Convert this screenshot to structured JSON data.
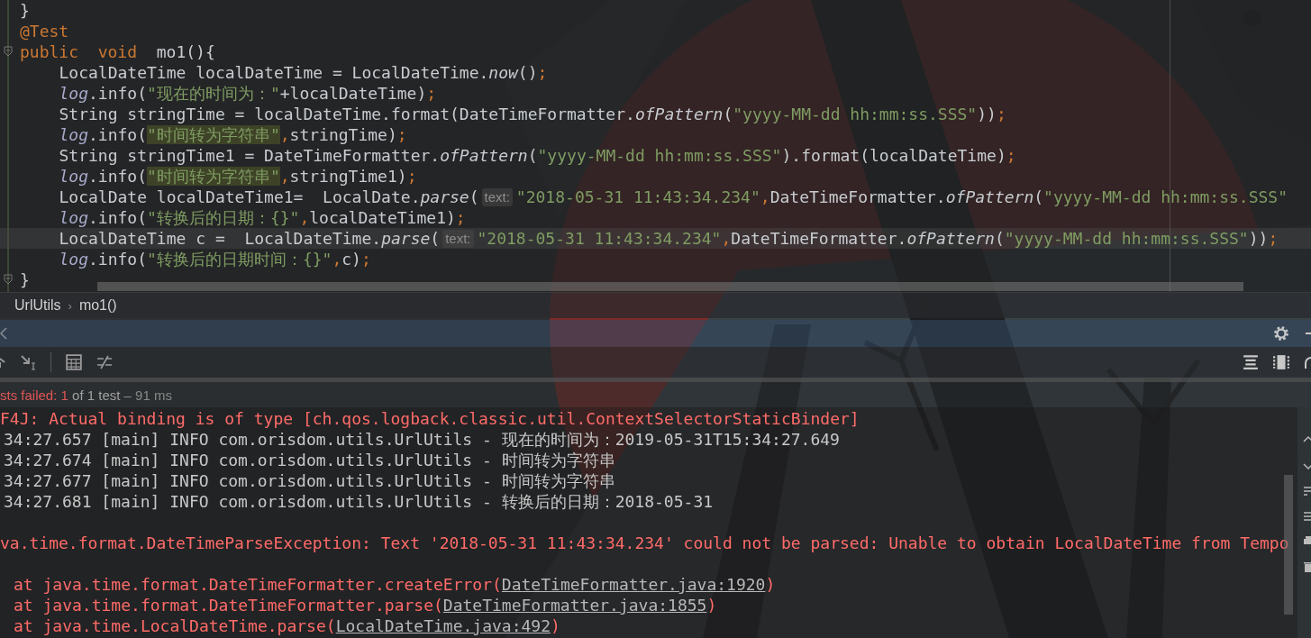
{
  "editor": {
    "code": [
      {
        "current": false,
        "segments": [
          {
            "text": "}",
            "kind": "plain"
          }
        ]
      },
      {
        "current": false,
        "segments": [
          {
            "text": "@Test",
            "kind": "annotation"
          }
        ]
      },
      {
        "current": false,
        "folded_marker": true,
        "segments": [
          {
            "text": "public  void  ",
            "kind": "keyword"
          },
          {
            "text": "mo1(){",
            "kind": "plain"
          }
        ],
        "children": [
          {
            "current": false,
            "segments": [
              {
                "text": "LocalDateTime localDateTime = LocalDateTime.",
                "kind": "plain"
              },
              {
                "text": "now",
                "kind": "italic"
              },
              {
                "text": "()",
                "kind": "plain"
              },
              {
                "text": ";",
                "kind": "punct"
              }
            ]
          },
          {
            "current": false,
            "segments": [
              {
                "text": "log",
                "kind": "static"
              },
              {
                "text": ".info(",
                "kind": "plain"
              },
              {
                "text": "\"现在的时间为：\"",
                "kind": "string"
              },
              {
                "text": "+localDateTime)",
                "kind": "plain"
              },
              {
                "text": ";",
                "kind": "punct"
              }
            ]
          },
          {
            "current": false,
            "segments": [
              {
                "text": "String stringTime = localDateTime.format(DateTimeFormatter.",
                "kind": "plain"
              },
              {
                "text": "ofPattern",
                "kind": "italic"
              },
              {
                "text": "(",
                "kind": "plain"
              },
              {
                "text": "\"yyyy-MM-dd hh:mm:ss.SSS\"",
                "kind": "string"
              },
              {
                "text": "))",
                "kind": "plain"
              },
              {
                "text": ";",
                "kind": "punct"
              }
            ]
          },
          {
            "current": false,
            "segments": [
              {
                "text": "log",
                "kind": "static"
              },
              {
                "text": ".info(",
                "kind": "plain"
              },
              {
                "text": "\"时间转为字符串\"",
                "kind": "string_marked"
              },
              {
                "text": ",",
                "kind": "punct"
              },
              {
                "text": "stringTime)",
                "kind": "plain"
              },
              {
                "text": ";",
                "kind": "punct"
              }
            ]
          },
          {
            "current": false,
            "segments": [
              {
                "text": "String stringTime1 = DateTimeFormatter.",
                "kind": "plain"
              },
              {
                "text": "ofPattern",
                "kind": "italic"
              },
              {
                "text": "(",
                "kind": "plain"
              },
              {
                "text": "\"yyyy-MM-dd hh:mm:ss.SSS\"",
                "kind": "string"
              },
              {
                "text": ").format(localDateTime)",
                "kind": "plain"
              },
              {
                "text": ";",
                "kind": "punct"
              }
            ]
          },
          {
            "current": false,
            "segments": [
              {
                "text": "log",
                "kind": "static"
              },
              {
                "text": ".info(",
                "kind": "plain"
              },
              {
                "text": "\"时间转为字符串\"",
                "kind": "string_marked"
              },
              {
                "text": ",",
                "kind": "punct"
              },
              {
                "text": "stringTime1)",
                "kind": "plain"
              },
              {
                "text": ";",
                "kind": "punct"
              }
            ]
          },
          {
            "current": false,
            "segments": [
              {
                "text": "LocalDate localDateTime1=  LocalDate.",
                "kind": "plain"
              },
              {
                "text": "parse",
                "kind": "italic"
              },
              {
                "text": "(",
                "kind": "plain"
              },
              {
                "text": "text:",
                "kind": "hint"
              },
              {
                "text": "\"2018-05-31 11:43:34.234\"",
                "kind": "string"
              },
              {
                "text": ",",
                "kind": "punct"
              },
              {
                "text": "DateTimeFormatter.",
                "kind": "plain"
              },
              {
                "text": "ofPattern",
                "kind": "italic"
              },
              {
                "text": "(",
                "kind": "plain"
              },
              {
                "text": "\"yyyy-MM-dd hh:mm:ss.SSS\"",
                "kind": "string"
              }
            ]
          },
          {
            "current": false,
            "segments": [
              {
                "text": "log",
                "kind": "static"
              },
              {
                "text": ".info(",
                "kind": "plain"
              },
              {
                "text": "\"转换后的日期：{}\"",
                "kind": "string"
              },
              {
                "text": ",",
                "kind": "punct"
              },
              {
                "text": "localDateTime1)",
                "kind": "plain"
              },
              {
                "text": ";",
                "kind": "punct"
              }
            ]
          },
          {
            "current": true,
            "segments": [
              {
                "text": "LocalDateTime c =  LocalDateTime.",
                "kind": "plain"
              },
              {
                "text": "parse",
                "kind": "italic"
              },
              {
                "text": "(",
                "kind": "plain"
              },
              {
                "text": "text:",
                "kind": "hint"
              },
              {
                "text": "\"2018-05-31 11:43:34.234\"",
                "kind": "string"
              },
              {
                "text": ",",
                "kind": "punct"
              },
              {
                "text": "DateTimeFormatter.",
                "kind": "plain"
              },
              {
                "text": "ofPattern",
                "kind": "italic"
              },
              {
                "text": "(",
                "kind": "plain"
              },
              {
                "text": "\"yyyy-MM-dd hh:mm:ss.SSS\"",
                "kind": "string"
              },
              {
                "text": "))",
                "kind": "plain"
              },
              {
                "text": ";",
                "kind": "punct"
              }
            ]
          },
          {
            "current": false,
            "segments": [
              {
                "text": "log",
                "kind": "static"
              },
              {
                "text": ".info(",
                "kind": "plain"
              },
              {
                "text": "\"转换后的日期时间：{}\"",
                "kind": "string"
              },
              {
                "text": ",",
                "kind": "punct"
              },
              {
                "text": "c)",
                "kind": "plain"
              },
              {
                "text": ";",
                "kind": "punct"
              }
            ]
          }
        ]
      },
      {
        "current": false,
        "folded_marker": true,
        "segments": [
          {
            "text": "}",
            "kind": "plain"
          }
        ]
      }
    ]
  },
  "breadcrumbs": [
    "UrlUtils",
    "mo1()"
  ],
  "breadcrumb_separator": "›",
  "run_panel": {
    "status": {
      "failed": "sts failed: 1",
      "total": "of 1 test",
      "duration": "– 91 ms"
    },
    "console": [
      {
        "kind": "error",
        "spaced": false,
        "text": "F4J: Actual binding is of type [ch.qos.logback.classic.util.ContextSelectorStaticBinder]"
      },
      {
        "kind": "info",
        "spaced": false,
        "text": "34:27.657 [main] INFO com.orisdom.utils.UrlUtils - 现在的时间为：2019-05-31T15:34:27.649"
      },
      {
        "kind": "info",
        "spaced": false,
        "text": "34:27.674 [main] INFO com.orisdom.utils.UrlUtils - 时间转为字符串"
      },
      {
        "kind": "info",
        "spaced": false,
        "text": "34:27.677 [main] INFO com.orisdom.utils.UrlUtils - 时间转为字符串"
      },
      {
        "kind": "info",
        "spaced": false,
        "text": "34:27.681 [main] INFO com.orisdom.utils.UrlUtils - 转换后的日期：2018-05-31"
      },
      {
        "kind": "error",
        "spaced": true,
        "text": "va.time.format.DateTimeParseException: Text '2018-05-31 11:43:34.234' could not be parsed: Unable to obtain LocalDateTime from Tempo"
      },
      {
        "kind": "stack",
        "spaced": true,
        "text": "at java.time.format.DateTimeFormatter.createError(",
        "link": "DateTimeFormatter.java:1920",
        "after": ")"
      },
      {
        "kind": "stack",
        "spaced": false,
        "text": "at java.time.format.DateTimeFormatter.parse(",
        "link": "DateTimeFormatter.java:1855",
        "after": ")"
      },
      {
        "kind": "stack",
        "spaced": false,
        "text": "at java.time.LocalDateTime.parse(",
        "link": "LocalDateTime.java:492",
        "after": ")"
      }
    ]
  }
}
